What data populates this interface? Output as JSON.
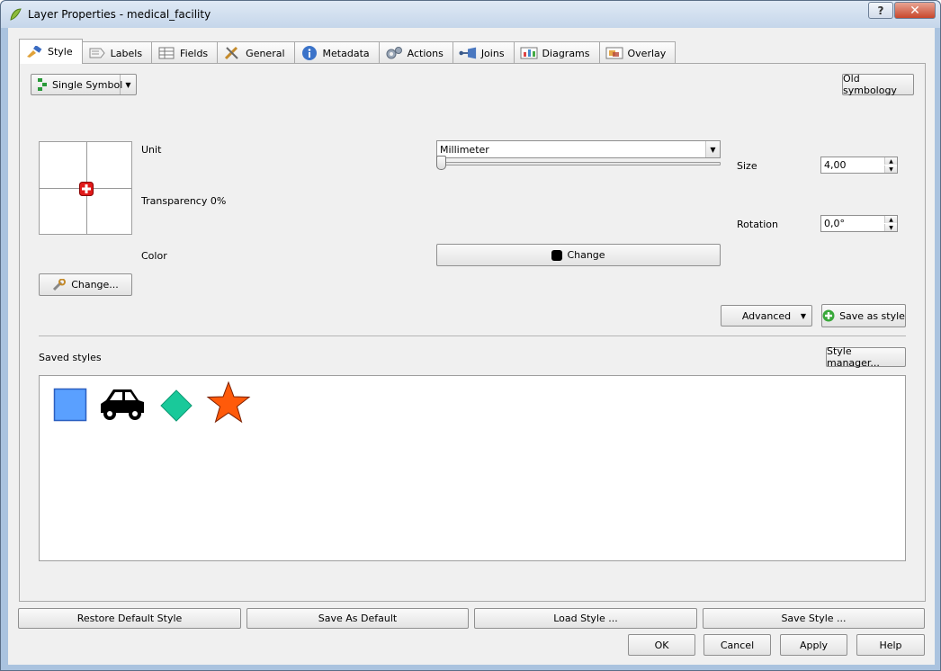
{
  "window": {
    "title": "Layer Properties - medical_facility",
    "help_label": "?",
    "close_label": "✕"
  },
  "tabs": [
    {
      "label": "Style",
      "icon": "brush-icon",
      "active": true
    },
    {
      "label": "Labels",
      "icon": "labels-icon"
    },
    {
      "label": "Fields",
      "icon": "table-icon"
    },
    {
      "label": "General",
      "icon": "tools-icon"
    },
    {
      "label": "Metadata",
      "icon": "info-icon"
    },
    {
      "label": "Actions",
      "icon": "gears-icon"
    },
    {
      "label": "Joins",
      "icon": "join-icon"
    },
    {
      "label": "Diagrams",
      "icon": "diagram-icon"
    },
    {
      "label": "Overlay",
      "icon": "overlay-icon"
    }
  ],
  "style": {
    "renderer_type": "Single Symbol",
    "old_symbology": "Old symbology",
    "unit_label": "Unit",
    "unit_value": "Millimeter",
    "transparency_label": "Transparency 0%",
    "transparency_value": 0,
    "color_label": "Color",
    "color_change": "Change",
    "symbol_color": "#000000",
    "size_label": "Size",
    "size_value": "4,00",
    "rotation_label": "Rotation",
    "rotation_value": "0,0°",
    "change_symbol": "Change...",
    "advanced": "Advanced",
    "save_as_style": "Save as style",
    "saved_styles_label": "Saved styles",
    "style_manager": "Style manager..."
  },
  "saved_styles": [
    {
      "name": "blue-square",
      "color": "#5aa0ff"
    },
    {
      "name": "car",
      "color": "#000000"
    },
    {
      "name": "green-diamond",
      "color": "#19c99a"
    },
    {
      "name": "orange-star",
      "color": "#ff5a0a"
    }
  ],
  "bottom": {
    "restore_default": "Restore Default Style",
    "save_as_default": "Save As Default",
    "load_style": "Load Style ...",
    "save_style": "Save Style ...",
    "ok": "OK",
    "cancel": "Cancel",
    "apply": "Apply",
    "help": "Help"
  }
}
